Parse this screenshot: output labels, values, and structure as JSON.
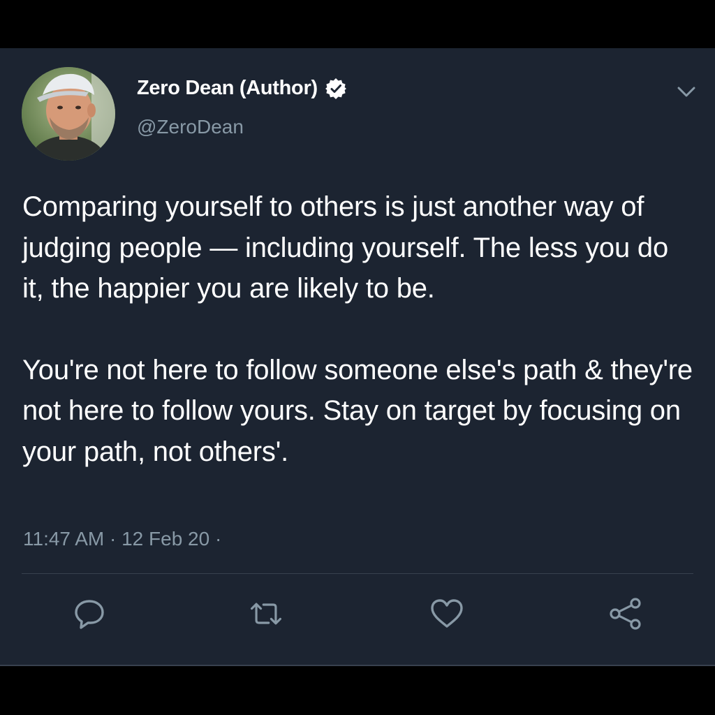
{
  "author": {
    "name": "Zero Dean (Author)",
    "handle": "@ZeroDean",
    "verified": true,
    "avatar_icon": "author-avatar-photo"
  },
  "header": {
    "menu_icon": "chevron-down-icon"
  },
  "tweet": {
    "paragraphs": [
      "Comparing yourself to others is just another way of judging people — including yourself. The less you do it, the happier you are likely to be.",
      "You're not here to follow someone else's path & they're not here to follow yours. Stay on target by focusing on your path, not others'."
    ],
    "timestamp": "11:47 AM · 12 Feb 20 ·"
  },
  "actions": [
    {
      "name": "reply",
      "icon": "reply-icon"
    },
    {
      "name": "retweet",
      "icon": "retweet-icon"
    },
    {
      "name": "like",
      "icon": "heart-icon"
    },
    {
      "name": "share",
      "icon": "share-icon"
    }
  ],
  "colors": {
    "background": "#1c2431",
    "text": "#ffffff",
    "secondary": "#8899a6",
    "divider": "#38414f"
  }
}
